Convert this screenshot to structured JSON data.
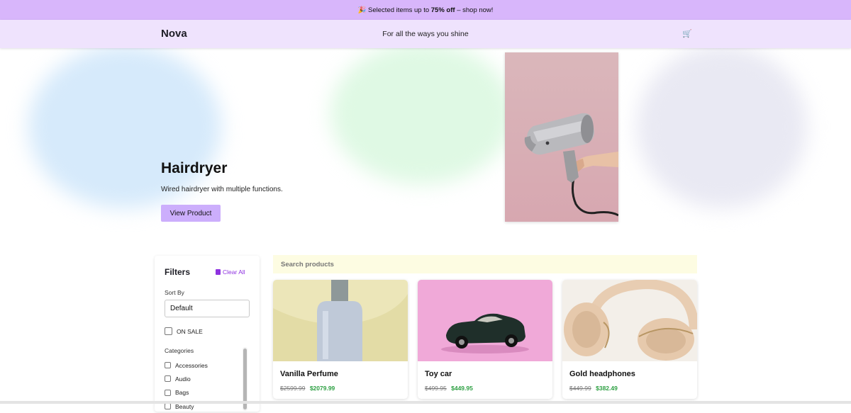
{
  "promo": {
    "emoji": "🎉",
    "text_before": "Selected items up to",
    "highlight": "75% off",
    "text_after": "– shop now!"
  },
  "header": {
    "brand": "Nova",
    "tagline": "For all the ways you shine",
    "cart_icon": "🛒"
  },
  "hero": {
    "title": "Hairdryer",
    "description": "Wired hairdryer with multiple functions.",
    "button_label": "View Product",
    "image_subject": "hairdryer"
  },
  "filters": {
    "title": "Filters",
    "clear_all_label": "Clear All",
    "sort_by_label": "Sort By",
    "sort_value": "Default",
    "on_sale_label": "ON SALE",
    "categories_label": "Categories",
    "categories": [
      "Accessories",
      "Audio",
      "Bags",
      "Beauty"
    ]
  },
  "search": {
    "placeholder": "Search products"
  },
  "products": [
    {
      "name": "Vanilla Perfume",
      "old_price": "$2599.99",
      "new_price": "$2079.99"
    },
    {
      "name": "Toy car",
      "old_price": "$499.95",
      "new_price": "$449.95"
    },
    {
      "name": "Gold headphones",
      "old_price": "$449.99",
      "new_price": "$382.49"
    }
  ],
  "colors": {
    "promo_bg": "#d8b6fb",
    "header_bg": "#efe3fd",
    "accent": "#8e32e0",
    "button_bg": "#ccaefc",
    "sale_price": "#2ea043",
    "search_bg": "#fdfce2"
  }
}
